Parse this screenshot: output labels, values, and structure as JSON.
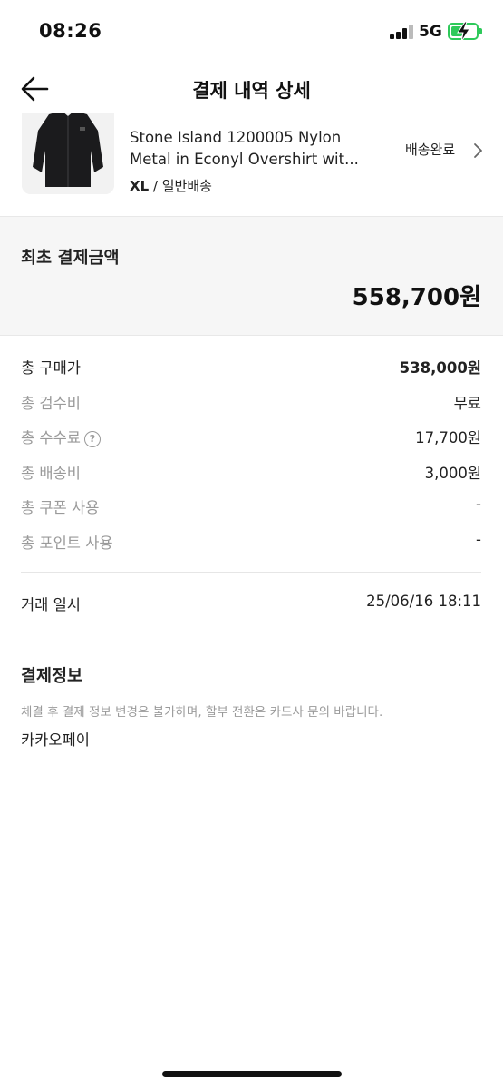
{
  "status_bar": {
    "time": "08:26",
    "network": "5G",
    "battery_color": "#2ec95a"
  },
  "header": {
    "title": "결제 내역 상세",
    "back_icon": "arrow-left-icon"
  },
  "product": {
    "name": "Stone Island 1200005 Nylon Metal in Econyl Overshirt wit...",
    "size": "XL",
    "separator": " / ",
    "shipping_type": "일반배송",
    "status": "배송완료",
    "status_icon": "chevron-right-icon"
  },
  "initial_payment": {
    "label": "최초 결제금액",
    "amount": "558,700원"
  },
  "breakdown": [
    {
      "label": "총 구매가",
      "value": "538,000원"
    },
    {
      "label": "총 검수비",
      "value": "무료"
    },
    {
      "label": "총 수수료",
      "value": "17,700원",
      "icon": "question-circle-icon",
      "icon_glyph": "?"
    },
    {
      "label": "총 배송비",
      "value": "3,000원"
    },
    {
      "label": "총 쿠폰 사용",
      "value": "-"
    },
    {
      "label": "총 포인트 사용",
      "value": "-"
    }
  ],
  "trade": {
    "label": "거래 일시",
    "value": "25/06/16 18:11"
  },
  "payment_info": {
    "title": "결제정보",
    "note": "체결 후 결제 정보 변경은 불가하며, 할부 전환은 카드사 문의 바랍니다.",
    "method": "카카오페이"
  }
}
